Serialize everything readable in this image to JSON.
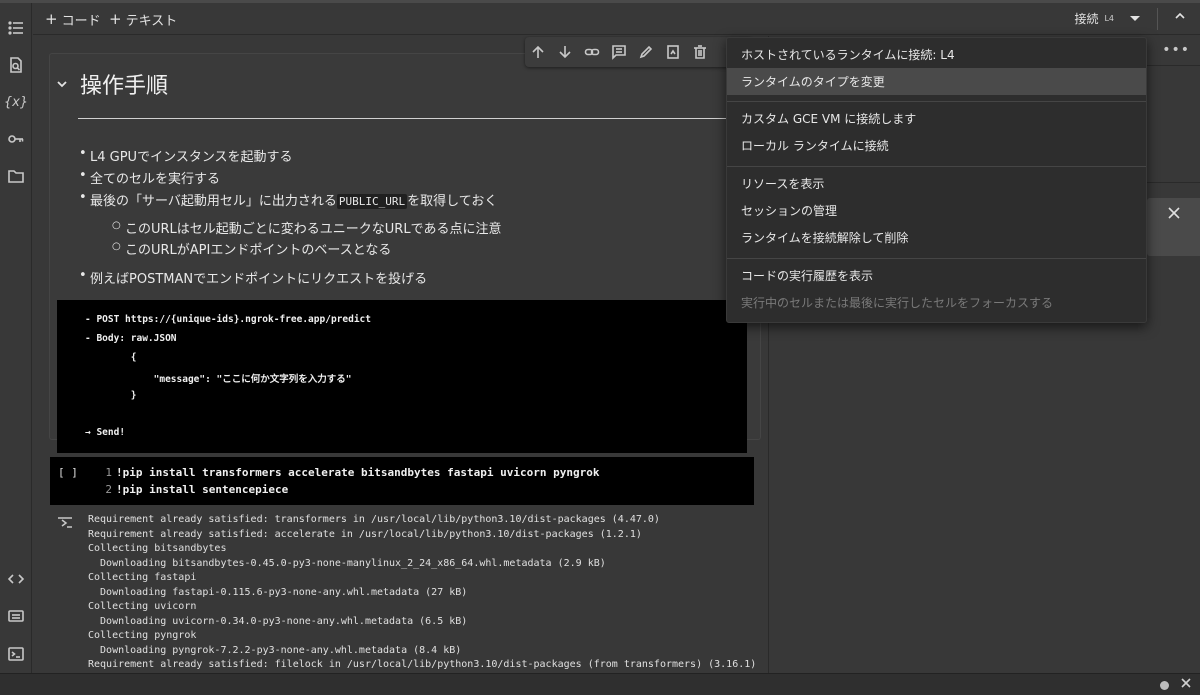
{
  "toolbar": {
    "add_code": "コード",
    "add_text": "テキスト",
    "connect_label": "接続",
    "runtime_badge": "L4"
  },
  "text_cell": {
    "title": "操作手順",
    "bullets": [
      "L4 GPUでインスタンスを起動する",
      "全てのセルを実行する",
      "最後の「サーバ起動用セル」に出力される",
      "を取得しておく",
      "例えばPOSTMANでエンドポイントにリクエストを投げる"
    ],
    "inline_code": "PUBLIC_URL",
    "sub_bullets": [
      "このURLはセル起動ごとに変わるユニークなURLである点に注意",
      "このURLがAPIエンドポイントのベースとなる"
    ],
    "code_block": [
      "- POST https://{unique-ids}.ngrok-free.app/predict",
      "- Body: raw.JSON",
      "        {",
      "            \"message\": \"ここに何か文字列を入力する\"",
      "        }",
      "→ Send!"
    ]
  },
  "code_cell": {
    "run_indicator": "[ ]",
    "line_numbers": [
      "1",
      "2"
    ],
    "lines": [
      "!pip install transformers accelerate bitsandbytes fastapi uvicorn pyngrok",
      "!pip install sentencepiece"
    ]
  },
  "output": {
    "lines": [
      "Requirement already satisfied: transformers in /usr/local/lib/python3.10/dist-packages (4.47.0)",
      "Requirement already satisfied: accelerate in /usr/local/lib/python3.10/dist-packages (1.2.1)",
      "Collecting bitsandbytes",
      "  Downloading bitsandbytes-0.45.0-py3-none-manylinux_2_24_x86_64.whl.metadata (2.9 kB)",
      "Collecting fastapi",
      "  Downloading fastapi-0.115.6-py3-none-any.whl.metadata (27 kB)",
      "Collecting uvicorn",
      "  Downloading uvicorn-0.34.0-py3-none-any.whl.metadata (6.5 kB)",
      "Collecting pyngrok",
      "  Downloading pyngrok-7.2.2-py3-none-any.whl.metadata (8.4 kB)",
      "Requirement already satisfied: filelock in /usr/local/lib/python3.10/dist-packages (from transformers) (3.16.1)"
    ]
  },
  "menu": {
    "items": [
      "ホストされているランタイムに接続: L4",
      "ランタイムのタイプを変更",
      "カスタム GCE VM に接続します",
      "ローカル ランタイムに接続",
      "リソースを表示",
      "セッションの管理",
      "ランタイムを接続解除して削除",
      "コードの実行履歴を表示",
      "実行中のセルまたは最後に実行したセルをフォーカスする"
    ]
  },
  "colors": {
    "background": "#383838",
    "menu_background": "#2d2d2d",
    "code_background": "#000000",
    "menu_highlight": "#4a4a4a"
  },
  "icons": {
    "rail": [
      "table-of-contents-icon",
      "find-icon",
      "variables-icon",
      "secrets-key-icon",
      "folder-icon",
      "code-snippets-icon",
      "command-palette-icon",
      "terminal-icon"
    ],
    "cell_toolbar": [
      "move-up-icon",
      "move-down-icon",
      "link-icon",
      "comment-icon",
      "edit-icon",
      "mirror-cell-icon",
      "delete-icon"
    ]
  }
}
